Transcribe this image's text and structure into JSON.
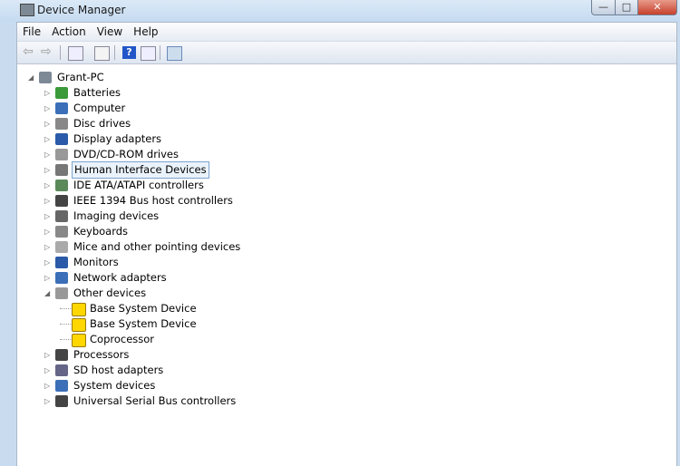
{
  "window": {
    "title": "Device Manager",
    "minimize": "—",
    "maximize": "□",
    "close": "✕"
  },
  "menu": [
    "File",
    "Action",
    "View",
    "Help"
  ],
  "toolbar": {
    "icons": [
      "back-icon",
      "forward-icon",
      "console-tree-icon",
      "properties-icon",
      "help-icon",
      "action-pane-icon",
      "scan-hardware-icon"
    ]
  },
  "tree": {
    "root": "Grant-PC",
    "items": [
      {
        "label": "Batteries",
        "icon": "battery-icon",
        "color": "#3a9a3a"
      },
      {
        "label": "Computer",
        "icon": "computer-icon",
        "color": "#3b6fb8"
      },
      {
        "label": "Disc drives",
        "icon": "disc-drive-icon",
        "color": "#888888"
      },
      {
        "label": "Display adapters",
        "icon": "display-adapter-icon",
        "color": "#2a5aa8"
      },
      {
        "label": "DVD/CD-ROM drives",
        "icon": "dvd-icon",
        "color": "#999999"
      },
      {
        "label": "Human Interface Devices",
        "icon": "hid-icon",
        "color": "#777777",
        "selected": true
      },
      {
        "label": "IDE ATA/ATAPI controllers",
        "icon": "ide-icon",
        "color": "#5a8a5a"
      },
      {
        "label": "IEEE 1394 Bus host controllers",
        "icon": "ieee1394-icon",
        "color": "#444444"
      },
      {
        "label": "Imaging devices",
        "icon": "camera-icon",
        "color": "#666666"
      },
      {
        "label": "Keyboards",
        "icon": "keyboard-icon",
        "color": "#888888"
      },
      {
        "label": "Mice and other pointing devices",
        "icon": "mouse-icon",
        "color": "#aaaaaa"
      },
      {
        "label": "Monitors",
        "icon": "monitor-icon",
        "color": "#2a5aa8"
      },
      {
        "label": "Network adapters",
        "icon": "network-icon",
        "color": "#3b6fb8"
      },
      {
        "label": "Other devices",
        "icon": "unknown-device-icon",
        "color": "#999999",
        "expanded": true,
        "children": [
          "Base System Device",
          "Base System Device",
          "Coprocessor"
        ]
      },
      {
        "label": "Processors",
        "icon": "processor-icon",
        "color": "#444444"
      },
      {
        "label": "SD host adapters",
        "icon": "sd-icon",
        "color": "#666688"
      },
      {
        "label": "System devices",
        "icon": "system-icon",
        "color": "#3b6fb8"
      },
      {
        "label": "Universal Serial Bus controllers",
        "icon": "usb-icon",
        "color": "#444444"
      }
    ]
  }
}
